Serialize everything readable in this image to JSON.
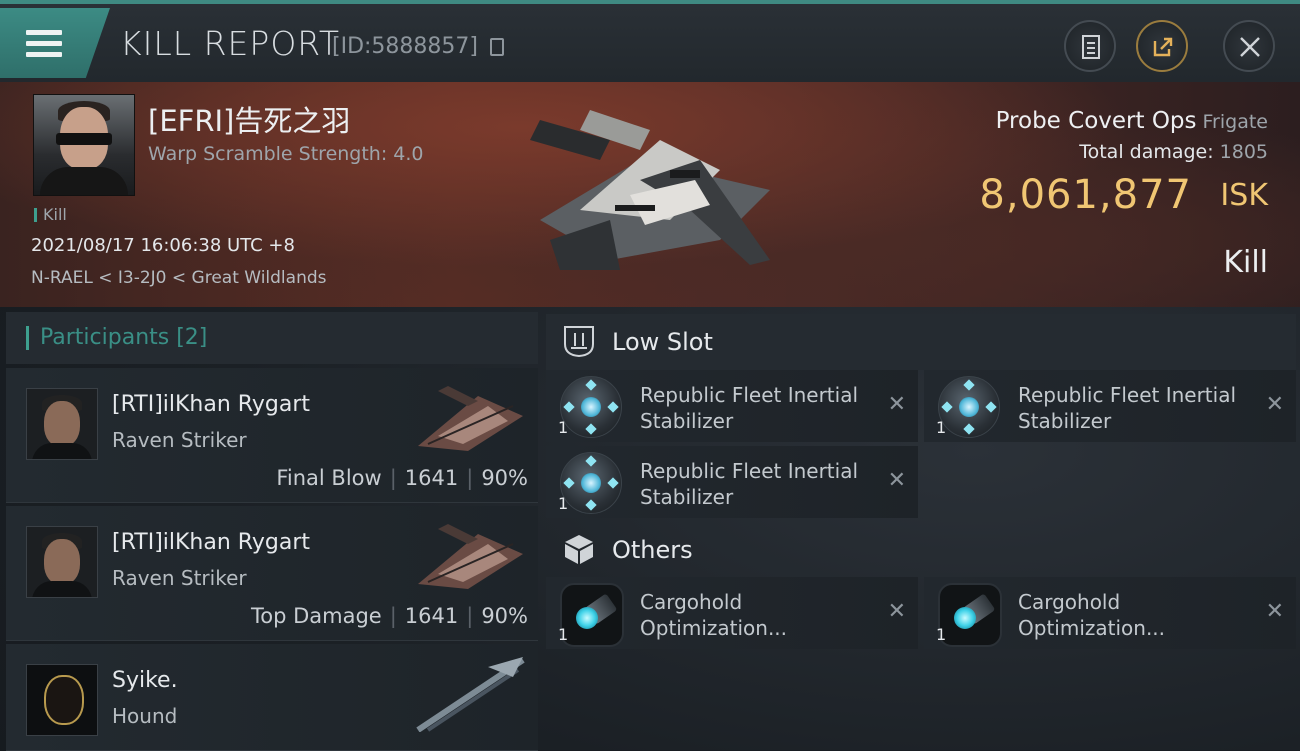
{
  "header": {
    "title": "KILL REPORT",
    "report_id": "[ID:5888857]"
  },
  "victim": {
    "name": "[EFRI]告死之羽",
    "warp_scramble": "Warp Scramble Strength: 4.0",
    "tag": "Kill",
    "datetime": "2021/08/17 16:06:38 UTC +8",
    "location": "N-RAEL < I3-2J0 < Great Wildlands",
    "ship_name": "Probe Covert Ops",
    "ship_class": "Frigate",
    "total_damage_label": "Total damage:",
    "total_damage": "1805",
    "isk_value": "8,061,877",
    "isk_unit": "ISK",
    "result": "Kill"
  },
  "participants": {
    "title": "Participants [2]",
    "list": [
      {
        "name": "[RTI]ilKhan Rygart",
        "ship": "Raven Striker",
        "role": "Final Blow",
        "damage": "1641",
        "percent": "90%"
      },
      {
        "name": "[RTI]ilKhan Rygart",
        "ship": "Raven Striker",
        "role": "Top Damage",
        "damage": "1641",
        "percent": "90%"
      },
      {
        "name": "Syike.",
        "ship": "Hound"
      }
    ]
  },
  "low_slot": {
    "title": "Low Slot",
    "items": [
      {
        "name": "Republic Fleet Inertial Stabilizer",
        "qty": "1"
      },
      {
        "name": "Republic Fleet Inertial Stabilizer",
        "qty": "1"
      },
      {
        "name": "Republic Fleet Inertial Stabilizer",
        "qty": "1"
      }
    ]
  },
  "others": {
    "title": "Others",
    "items": [
      {
        "name": "Cargohold Optimization...",
        "qty": "1"
      },
      {
        "name": "Cargohold Optimization...",
        "qty": "1"
      }
    ]
  },
  "icons": {
    "close": "✕"
  },
  "colors": {
    "accent": "#3ea08f",
    "isk": "#f0c673"
  }
}
